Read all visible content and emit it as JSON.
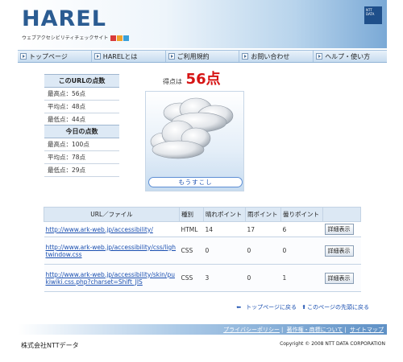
{
  "header": {
    "logo": "HAREL",
    "tagline": "ウェブアクセシビリティチェックサイト",
    "tagline_marks": [
      "#d83a3a",
      "#f0a22a",
      "#3aa0d8"
    ],
    "corner_badge": "NTT DATA"
  },
  "nav": {
    "items": [
      {
        "label": "トップページ"
      },
      {
        "label": "HARELとは"
      },
      {
        "label": "ご利用規約"
      },
      {
        "label": "お問い合わせ"
      },
      {
        "label": "ヘルプ・使い方"
      }
    ]
  },
  "url_scores": {
    "title": "このURLの点数",
    "rows": [
      "最高点：56点",
      "平均点：48点",
      "最低点：44点"
    ]
  },
  "today_scores": {
    "title": "今日の点数",
    "rows": [
      "最高点：100点",
      "平均点：78点",
      "最低点：29点"
    ]
  },
  "score": {
    "label": "得点は",
    "value": "56点",
    "color": "#d61414",
    "weather_icon": "cloudy-icon",
    "weather_button": "もうすこし"
  },
  "table": {
    "headers": [
      "URL／ファイル",
      "種別",
      "晴れポイント",
      "雨ポイント",
      "曇りポイント",
      ""
    ],
    "rows": [
      {
        "url": "http://www.ark-web.jp/accessibility/",
        "type": "HTML",
        "sunny": "14",
        "rain": "17",
        "cloudy": "6",
        "action": "詳細表示"
      },
      {
        "url": "http://www.ark-web.jp/accessibility/css/lightwindow.css",
        "type": "CSS",
        "sunny": "0",
        "rain": "0",
        "cloudy": "0",
        "action": "詳細表示"
      },
      {
        "url": "http://www.ark-web.jp/accessibility/skin/pukiwiki.css.php?charset=Shift_JIS",
        "type": "CSS",
        "sunny": "3",
        "rain": "0",
        "cloudy": "1",
        "action": "詳細表示"
      }
    ]
  },
  "pagelinks": {
    "back": "トップページに戻る",
    "top": "このページの先頭に戻る"
  },
  "footer": {
    "links": [
      "プライバシーポリシー",
      "著作権・商標について",
      "サイトマップ"
    ],
    "company": "株式会社NTTデータ",
    "copyright": "Copyright © 2008 NTT DATA CORPORATION"
  }
}
